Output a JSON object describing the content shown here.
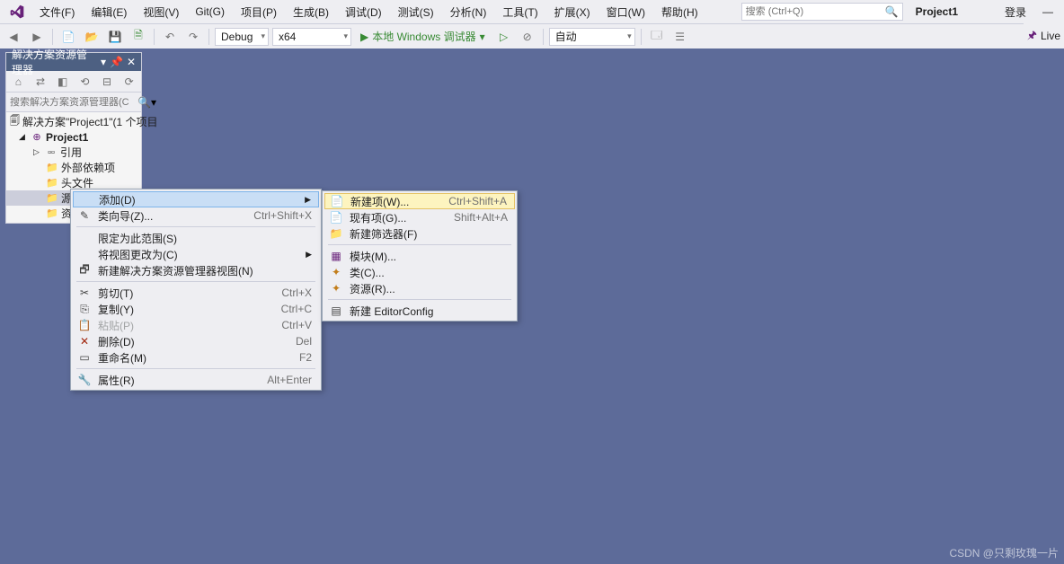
{
  "menubar": {
    "items": [
      "文件(F)",
      "编辑(E)",
      "视图(V)",
      "Git(G)",
      "项目(P)",
      "生成(B)",
      "调试(D)",
      "测试(S)",
      "分析(N)",
      "工具(T)",
      "扩展(X)",
      "窗口(W)",
      "帮助(H)"
    ],
    "search_placeholder": "搜索 (Ctrl+Q)",
    "project": "Project1",
    "login": "登录",
    "live": "Live"
  },
  "toolbar": {
    "config": "Debug",
    "platform": "x64",
    "debugger": "本地 Windows 调试器",
    "auto": "自动"
  },
  "panel": {
    "title": "解决方案资源管理器",
    "search_placeholder": "搜索解决方案资源管理器(C",
    "solution": "解决方案\"Project1\"(1 个项目",
    "project": "Project1",
    "refs": "引用",
    "external": "外部依赖项",
    "headers": "头文件",
    "sources": "源文件",
    "resources": "资源"
  },
  "ctx1": {
    "add": "添加(D)",
    "wizard": "类向导(Z)...",
    "wizard_s": "Ctrl+Shift+X",
    "scope": "限定为此范围(S)",
    "changeview": "将视图更改为(C)",
    "newview": "新建解决方案资源管理器视图(N)",
    "cut": "剪切(T)",
    "cut_s": "Ctrl+X",
    "copy": "复制(Y)",
    "copy_s": "Ctrl+C",
    "paste": "粘贴(P)",
    "paste_s": "Ctrl+V",
    "delete": "删除(D)",
    "delete_s": "Del",
    "rename": "重命名(M)",
    "rename_s": "F2",
    "props": "属性(R)",
    "props_s": "Alt+Enter"
  },
  "ctx2": {
    "newitem": "新建项(W)...",
    "newitem_s": "Ctrl+Shift+A",
    "existing": "现有项(G)...",
    "existing_s": "Shift+Alt+A",
    "filter": "新建筛选器(F)",
    "module": "模块(M)...",
    "class": "类(C)...",
    "resource": "资源(R)...",
    "editorconfig": "新建 EditorConfig"
  },
  "watermark": "CSDN @只剩玫瑰一片"
}
